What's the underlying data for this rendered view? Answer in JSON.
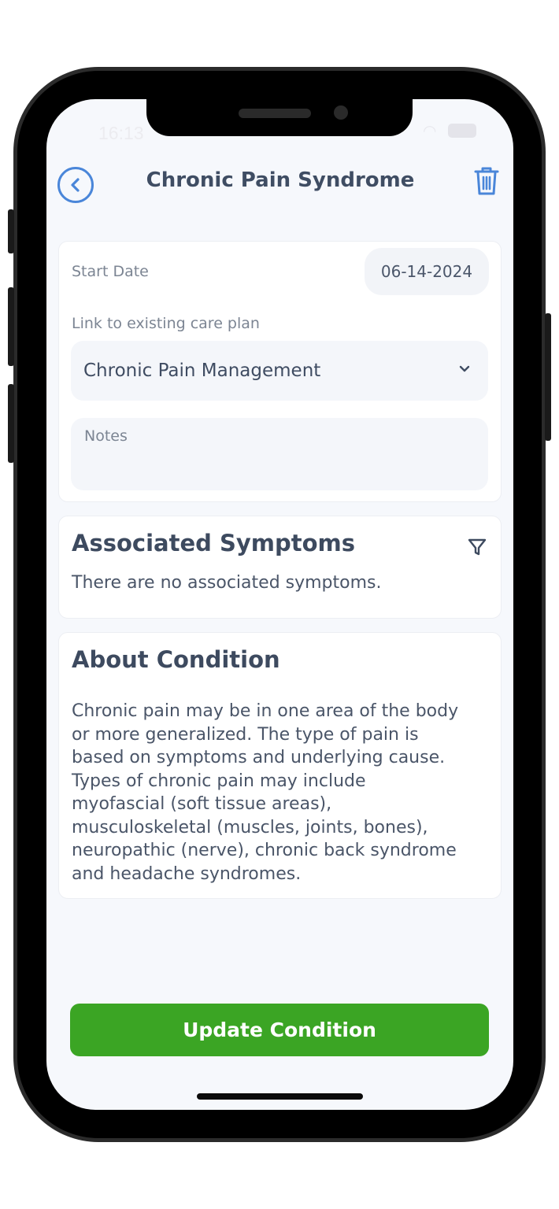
{
  "status_bar": {
    "time": "16:13"
  },
  "header": {
    "title": "Chronic Pain Syndrome"
  },
  "details": {
    "start_date_label": "Start Date",
    "start_date_value": "06-14-2024",
    "care_plan_label": "Link to existing care plan",
    "care_plan_value": "Chronic Pain Management",
    "notes_placeholder": "Notes"
  },
  "symptoms": {
    "title": "Associated Symptoms",
    "empty_text": "There are no associated symptoms."
  },
  "about": {
    "title": "About Condition",
    "lines": [
      "Chronic pain may be in one area of the body",
      "or more generalized. The type of pain is",
      "based on symptoms and underlying cause.",
      "Types of chronic pain may include",
      "myofascial (soft tissue areas),",
      "musculoskeletal (muscles, joints, bones),",
      "neuropathic (nerve), chronic back syndrome",
      "and headache syndromes."
    ]
  },
  "footer": {
    "update_label": "Update Condition"
  },
  "colors": {
    "accent_blue": "#4a86d9",
    "primary_green": "#3ba524",
    "heading": "#3d4a5f"
  }
}
